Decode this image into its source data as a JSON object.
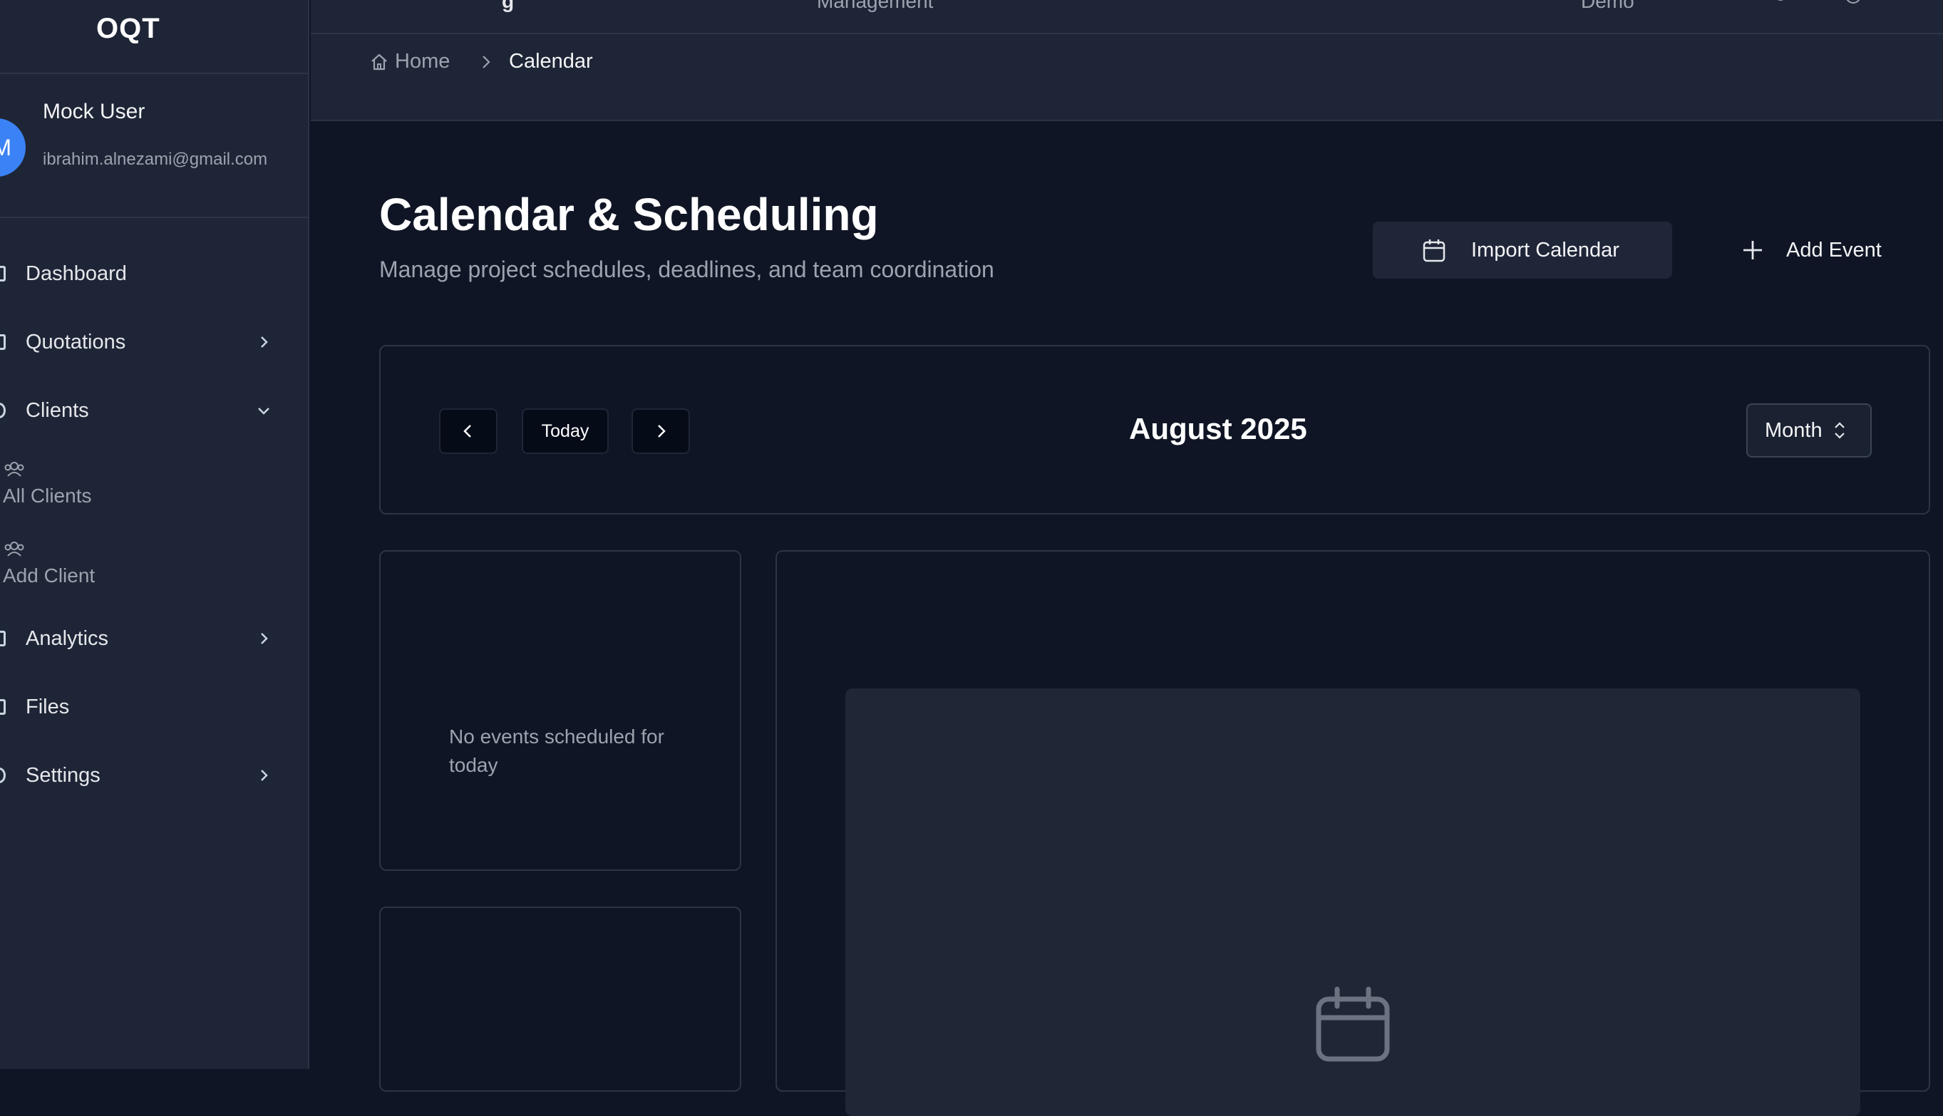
{
  "app": {
    "brand": "OQT"
  },
  "topbar": {
    "item1": "g",
    "item2": "Management",
    "item3": "Demo"
  },
  "user": {
    "initial": "M",
    "name": "Mock User",
    "email": "ibrahim.alnezami@gmail.com"
  },
  "sidebar": {
    "items": [
      {
        "label": "Dashboard"
      },
      {
        "label": "Quotations"
      },
      {
        "label": "Clients"
      },
      {
        "label": "All Clients"
      },
      {
        "label": "Add Client"
      },
      {
        "label": "Analytics"
      },
      {
        "label": "Files"
      },
      {
        "label": "Settings"
      }
    ]
  },
  "breadcrumb": {
    "home": "Home",
    "current": "Calendar"
  },
  "page": {
    "title": "Calendar & Scheduling",
    "subtitle": "Manage project schedules, deadlines, and team coordination"
  },
  "actions": {
    "import": "Import Calendar",
    "add": "Add Event"
  },
  "calendar_toolbar": {
    "today": "Today",
    "month_label": "August 2025",
    "view": "Month"
  },
  "today_card": {
    "empty": "No events scheduled for today"
  },
  "colors": {
    "accent": "#3b82f6",
    "background": "#0f1524",
    "sidebar": "#1e2536"
  }
}
